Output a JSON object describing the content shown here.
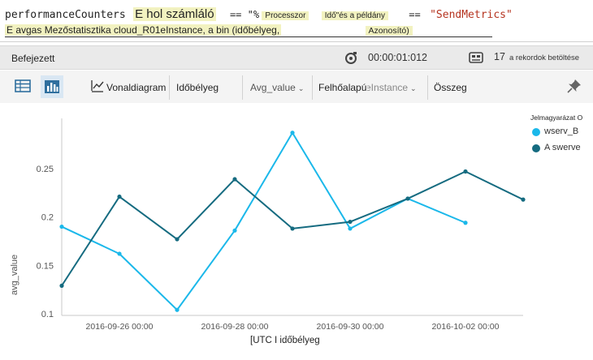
{
  "query": {
    "line1": {
      "table": "performanceCounters",
      "text_a": "E hol számláló",
      "op1": "== \"%",
      "text_b": "Processzor",
      "text_c": "Idő\"és a példány",
      "op2": "==",
      "string_value": "\"SendMetrics\""
    },
    "line2": {
      "text_a": "E avgas Mezőstatisztika cloud_R01eInstance, a bin (időbélyeg,",
      "text_b": "Azonosító)"
    }
  },
  "status": {
    "state": "Befejezett",
    "elapsed": "00:00:01:012",
    "record_count": "17",
    "record_label": "a rekordok betöltése"
  },
  "toolbar": {
    "linechart_label": "Vonaldiagram",
    "timestamp_label": "Időbélyeg",
    "avg_value_label": "Avg_value",
    "cloud_label": "Felhőalapú",
    "role_instance_label": "RoleInstance",
    "sum_label": "Összeg"
  },
  "colors": {
    "series_a": "#1bb8ea",
    "series_b": "#156b80"
  },
  "icons": [
    "table-icon",
    "bar-chart-icon",
    "line-chart-icon",
    "timer-icon",
    "records-icon",
    "pin-icon"
  ],
  "chart_data": {
    "type": "line",
    "xlabel": "[UTC I időbélyeg",
    "ylabel": "avg_value",
    "ylim": [
      0.1,
      0.3
    ],
    "yticks": [
      "0.1",
      "0.15",
      "0.2",
      "0.25"
    ],
    "x_tick_labels": [
      "2016-09-26 00:00",
      "2016-09-28 00:00",
      "2016-09-30 00:00",
      "2016-10-02 00:00"
    ],
    "legend_title": "Jelmagyarázat O",
    "legend_position": "top-right",
    "grid": false,
    "x": [
      "2016-09-25",
      "2016-09-26",
      "2016-09-27",
      "2016-09-28",
      "2016-09-29",
      "2016-09-30",
      "2016-10-01",
      "2016-10-02",
      "2016-10-03"
    ],
    "series": [
      {
        "name": "wserv_B",
        "color": "#1bb8ea",
        "values": [
          0.19,
          0.162,
          0.104,
          0.186,
          0.287,
          0.188,
          0.219,
          0.194,
          null
        ]
      },
      {
        "name": "A swerve",
        "color": "#156b80",
        "values": [
          0.129,
          0.221,
          0.177,
          0.239,
          0.188,
          0.195,
          0.219,
          0.247,
          0.218
        ]
      }
    ]
  }
}
